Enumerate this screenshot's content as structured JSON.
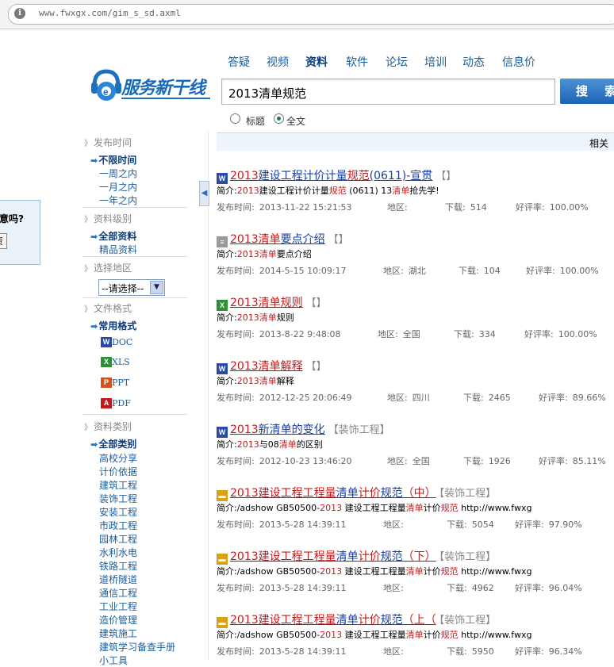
{
  "browser": {
    "url": "www.fwxgx.com/gim_s_sd.axml"
  },
  "popup": {
    "question": "意吗?",
    "button": "资"
  },
  "logo": {
    "text": "服务新干线"
  },
  "nav": [
    "答疑",
    "视频",
    "资料",
    "软件",
    "论坛",
    "培训",
    "动态",
    "信息价"
  ],
  "nav_active": "资料",
  "search": {
    "query": "2013清单规范",
    "button": "搜 索",
    "radio_title": "标题",
    "radio_full": "全文",
    "selected": "全文"
  },
  "sidebar": {
    "pubtime": {
      "title": "发布时间",
      "selected": "不限时间",
      "options": [
        "一周之内",
        "一月之内",
        "一年之内"
      ]
    },
    "level": {
      "title": "资料级别",
      "selected": "全部资料",
      "options": [
        "精品资料"
      ]
    },
    "region": {
      "title": "选择地区",
      "select": "--请选择--"
    },
    "format": {
      "title": "文件格式",
      "selected": "常用格式",
      "options": [
        "DOC",
        "XLS",
        "PPT",
        "PDF"
      ]
    },
    "category": {
      "title": "资料类别",
      "selected": "全部类别",
      "options": [
        "高校分享",
        "计价依据",
        "建筑工程",
        "装饰工程",
        "安装工程",
        "市政工程",
        "园林工程",
        "水利水电",
        "铁路工程",
        "道桥隧道",
        "通信工程",
        "工业工程",
        "造价管理",
        "建筑施工",
        "建筑学习备查手册",
        "小工具"
      ]
    }
  },
  "results_bar": {
    "text": "相关"
  },
  "results": [
    {
      "icon": "word",
      "title_parts": [
        "2013",
        "建设工程计价计量",
        "规范",
        "(0611)-宣贯"
      ],
      "title_hl": [
        true,
        false,
        true,
        false
      ],
      "tag": "【】",
      "summary_label": "简介:",
      "summary_parts": [
        "2013",
        "建设工程计价计量",
        "规范",
        " (0611)  13",
        "清单",
        "抢先学!"
      ],
      "summary_hl": [
        true,
        false,
        true,
        false,
        true,
        false
      ],
      "pub_label": "发布时间:",
      "pub_time": "2013-11-22 15:21:53",
      "region_label": "地区:",
      "region": "",
      "dl_label": "下载:",
      "downloads": "514",
      "rate_label": "好评率:",
      "rate": "100.00%"
    },
    {
      "icon": "doc",
      "title_parts": [
        "2013",
        "清单",
        "要点介绍"
      ],
      "title_hl": [
        true,
        true,
        false
      ],
      "tag": "【】",
      "summary_label": "简介:",
      "summary_parts": [
        "2013",
        "清单",
        "要点介绍"
      ],
      "summary_hl": [
        true,
        true,
        false
      ],
      "pub_label": "发布时间:",
      "pub_time": "2014-5-15 10:09:17",
      "region_label": "地区:",
      "region": "湖北",
      "dl_label": "下载:",
      "downloads": "104",
      "rate_label": "好评率:",
      "rate": "100.00%"
    },
    {
      "icon": "excel",
      "title_parts": [
        "2013",
        "清单",
        "规则"
      ],
      "title_hl": [
        true,
        true,
        true
      ],
      "tag": "【】",
      "summary_label": "简介:",
      "summary_parts": [
        "2013",
        "清单",
        "规则"
      ],
      "summary_hl": [
        true,
        true,
        false
      ],
      "pub_label": "发布时间:",
      "pub_time": "2013-8-22 9:48:08",
      "region_label": "地区:",
      "region": "全国",
      "dl_label": "下载:",
      "downloads": "334",
      "rate_label": "好评率:",
      "rate": "100.00%"
    },
    {
      "icon": "word",
      "title_parts": [
        "2013",
        "清单",
        "解释"
      ],
      "title_hl": [
        true,
        true,
        true
      ],
      "tag": "【】",
      "summary_label": "简介:",
      "summary_parts": [
        "2013",
        "清单",
        "解释"
      ],
      "summary_hl": [
        true,
        true,
        false
      ],
      "pub_label": "发布时间:",
      "pub_time": "2012-12-25 20:06:49",
      "region_label": "地区:",
      "region": "四川",
      "dl_label": "下载:",
      "downloads": "2465",
      "rate_label": "好评率:",
      "rate": "89.66%"
    },
    {
      "icon": "word",
      "title_parts": [
        "2013",
        "新清单的变化"
      ],
      "title_hl": [
        true,
        false
      ],
      "tag": "【装饰工程】",
      "summary_label": "简介:",
      "summary_parts": [
        "2013",
        "与08",
        "清单",
        "的区别"
      ],
      "summary_hl": [
        true,
        false,
        true,
        false
      ],
      "pub_label": "发布时间:",
      "pub_time": "2012-10-23 13:46:20",
      "region_label": "地区:",
      "region": "全国",
      "dl_label": "下载:",
      "downloads": "1926",
      "rate_label": "好评率:",
      "rate": "85.11%"
    },
    {
      "icon": "folder",
      "title_parts": [
        "2013",
        "建设工程工程量",
        "清单",
        "计价",
        "规范",
        "（中）"
      ],
      "title_hl": [
        true,
        true,
        false,
        true,
        false,
        true
      ],
      "tag": "【装饰工程】",
      "summary_label": "简介:",
      "summary_parts": [
        "/adshow GB50500-",
        "2013",
        " 建设工程工程量",
        "清单",
        "计价",
        "规范",
        " http://www.fwxg"
      ],
      "summary_hl": [
        false,
        true,
        false,
        true,
        false,
        true,
        false
      ],
      "pub_label": "发布时间:",
      "pub_time": "2013-5-28 14:39:11",
      "region_label": "地区:",
      "region": "",
      "dl_label": "下载:",
      "downloads": "5054",
      "rate_label": "好评率:",
      "rate": "97.90%"
    },
    {
      "icon": "folder",
      "title_parts": [
        "2013",
        "建设工程工程量",
        "清单",
        "计价",
        "规范",
        "（下）"
      ],
      "title_hl": [
        true,
        true,
        false,
        true,
        false,
        true
      ],
      "tag": "【装饰工程】",
      "summary_label": "简介:",
      "summary_parts": [
        "/adshow GB50500-",
        "2013",
        " 建设工程工程量",
        "清单",
        "计价",
        "规范",
        " http://www.fwxg"
      ],
      "summary_hl": [
        false,
        true,
        false,
        true,
        false,
        true,
        false
      ],
      "pub_label": "发布时间:",
      "pub_time": "2013-5-28 14:39:11",
      "region_label": "地区:",
      "region": "",
      "dl_label": "下载:",
      "downloads": "4962",
      "rate_label": "好评率:",
      "rate": "96.04%"
    },
    {
      "icon": "folder",
      "title_parts": [
        "2013",
        "建设工程工程量",
        "清单",
        "计价",
        "规范",
        "（上（"
      ],
      "title_hl": [
        true,
        true,
        false,
        true,
        false,
        true
      ],
      "tag": "【装饰工程】",
      "summary_label": "简介:",
      "summary_parts": [
        "/adshow GB50500-",
        "2013",
        " 建设工程工程量",
        "清单",
        "计价",
        "规范",
        " http://www.fwxg"
      ],
      "summary_hl": [
        false,
        true,
        false,
        true,
        false,
        true,
        false
      ],
      "pub_label": "发布时间:",
      "pub_time": "2013-5-28 14:39:11",
      "region_label": "地区:",
      "region": "",
      "dl_label": "下载:",
      "downloads": "5950",
      "rate_label": "好评率:",
      "rate": "96.34%"
    }
  ],
  "colors": {
    "link": "#1a3fa0",
    "highlight": "#c21b1b",
    "nav": "#1a5d9e",
    "button": "#1c63b3"
  }
}
